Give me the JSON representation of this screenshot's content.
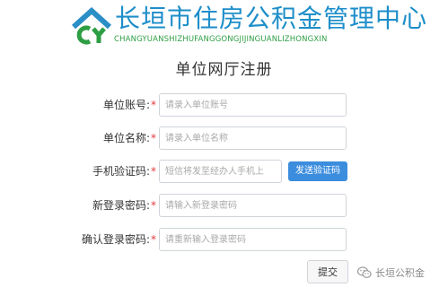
{
  "header": {
    "org_name": "长垣市住房公积金管理中心",
    "org_pinyin": "CHANGYUANSHIZHUFANGGONGJIJINGUANLIZHONGXIN"
  },
  "page_title": "单位网厅注册",
  "required_mark": "*",
  "form": {
    "account": {
      "label": "单位账号:",
      "placeholder": "请录入单位账号"
    },
    "name": {
      "label": "单位名称:",
      "placeholder": "请录入单位名称"
    },
    "sms_code": {
      "label": "手机验证码:",
      "placeholder": "短信将发至经办人手机上",
      "send_button": "发送验证码"
    },
    "new_password": {
      "label": "新登录密码:",
      "placeholder": "请输入新登录密码"
    },
    "confirm_password": {
      "label": "确认登录密码:",
      "placeholder": "请重新输入登录密码"
    },
    "submit_label": "提交"
  },
  "watermark": {
    "text": "长垣公积金"
  },
  "colors": {
    "brand_blue": "#1d8ec9",
    "brand_green": "#2e9e44",
    "button_blue": "#3c8dde",
    "required_red": "#e4393c"
  },
  "icons": {
    "logo": "house-logo-icon",
    "watermark": "wechat-icon"
  }
}
